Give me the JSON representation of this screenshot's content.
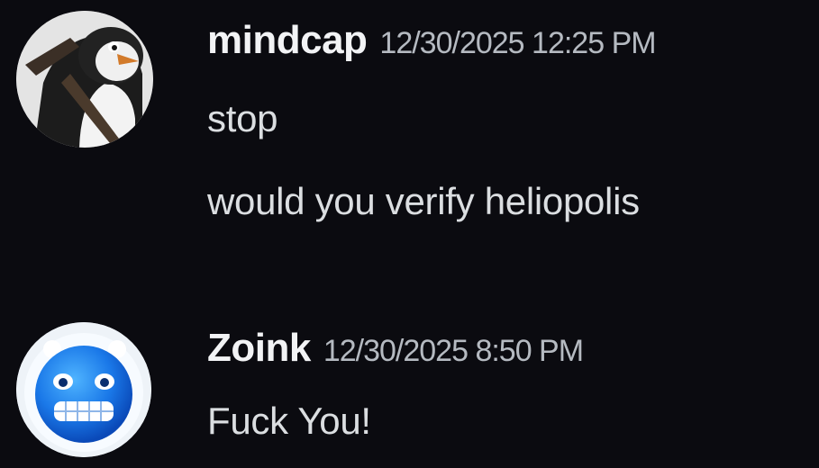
{
  "messages": [
    {
      "username": "mindcap",
      "timestamp": "12/30/2025 12:25 PM",
      "avatar_icon": "penguin-avatar-icon",
      "lines": [
        "stop",
        "would you verify heliopolis"
      ]
    },
    {
      "username": "Zoink",
      "timestamp": "12/30/2025 8:50 PM",
      "avatar_icon": "blue-grimace-emoji-avatar-icon",
      "lines": [
        "Fuck You!"
      ]
    }
  ],
  "colors": {
    "background": "#0b0b10",
    "username": "#f2f3f5",
    "timestamp": "#b5bac1",
    "message_text": "#dbdee1"
  }
}
